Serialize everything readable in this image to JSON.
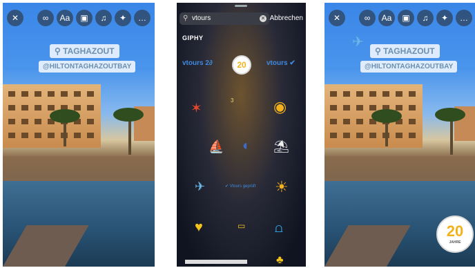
{
  "left_story": {
    "toolbar": [
      "✕",
      "∞",
      "Aa",
      "▣",
      "♫",
      "✦",
      "…"
    ],
    "location": "TAGHAZOUT",
    "mention": "@HILTONTAGHAZOUTBAY"
  },
  "sticker_picker": {
    "search_value": "vtours",
    "cancel_label": "Abbrechen",
    "section_label": "GIPHY",
    "stickers": [
      {
        "name": "vtours-20-logo-sticker",
        "glyph": "vtours 2∂"
      },
      {
        "name": "20-jahre-badge-sticker",
        "glyph": "20"
      },
      {
        "name": "vtours-check-logo-sticker",
        "glyph": "vtours ✔"
      },
      {
        "name": "starfish-sticker",
        "glyph": "✶"
      },
      {
        "name": "small-number-sticker",
        "glyph": "3"
      },
      {
        "name": "compass-sticker",
        "glyph": "◉"
      },
      {
        "name": "sailboat-sticker",
        "glyph": "⛵"
      },
      {
        "name": "beach-ball-sticker",
        "glyph": "◐"
      },
      {
        "name": "beach-scene-sticker",
        "glyph": "⛱"
      },
      {
        "name": "airplane-sticker",
        "glyph": "✈"
      },
      {
        "name": "vtours-checked-text-sticker",
        "glyph": "✔ Vtours geprüft"
      },
      {
        "name": "sun-sticker",
        "glyph": "☀"
      },
      {
        "name": "sun-heart-sticker",
        "glyph": "♥"
      },
      {
        "name": "chat-bubble-sticker",
        "glyph": "▭"
      },
      {
        "name": "flip-flops-sticker",
        "glyph": "⩍"
      },
      {
        "name": "palm-sticker",
        "glyph": "♣"
      }
    ]
  },
  "right_story": {
    "toolbar": [
      "✕",
      "∞",
      "Aa",
      "▣",
      "♫",
      "✦",
      "…"
    ],
    "location": "TAGHAZOUT",
    "mention": "@HILTONTAGHAZOUTBAY",
    "badge_number": "20",
    "badge_text": "JAHRE"
  }
}
